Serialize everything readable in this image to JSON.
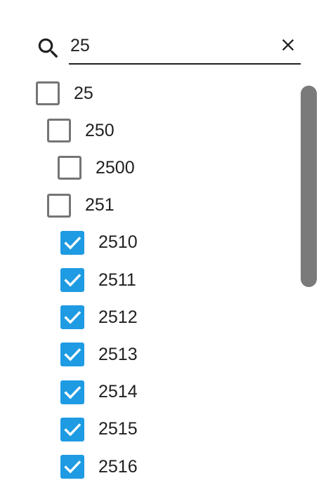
{
  "search": {
    "value": "25",
    "placeholder": ""
  },
  "icons": {
    "search": "search-icon",
    "clear": "close-icon",
    "check": "check-icon"
  },
  "colors": {
    "accent": "#1e9be2",
    "checkbox_border": "#757575",
    "scrollbar": "#7a7a7a",
    "text": "#212121"
  },
  "tree": {
    "items": [
      {
        "label": "25",
        "level": 0,
        "checked": false
      },
      {
        "label": "250",
        "level": 1,
        "checked": false
      },
      {
        "label": "2500",
        "level": 2,
        "checked": false
      },
      {
        "label": "251",
        "level": 1,
        "checked": false
      },
      {
        "label": "2510",
        "level": 2,
        "checked": true
      },
      {
        "label": "2511",
        "level": 2,
        "checked": true
      },
      {
        "label": "2512",
        "level": 2,
        "checked": true
      },
      {
        "label": "2513",
        "level": 2,
        "checked": true
      },
      {
        "label": "2514",
        "level": 2,
        "checked": true
      },
      {
        "label": "2515",
        "level": 2,
        "checked": true
      },
      {
        "label": "2516",
        "level": 2,
        "checked": true
      }
    ]
  }
}
